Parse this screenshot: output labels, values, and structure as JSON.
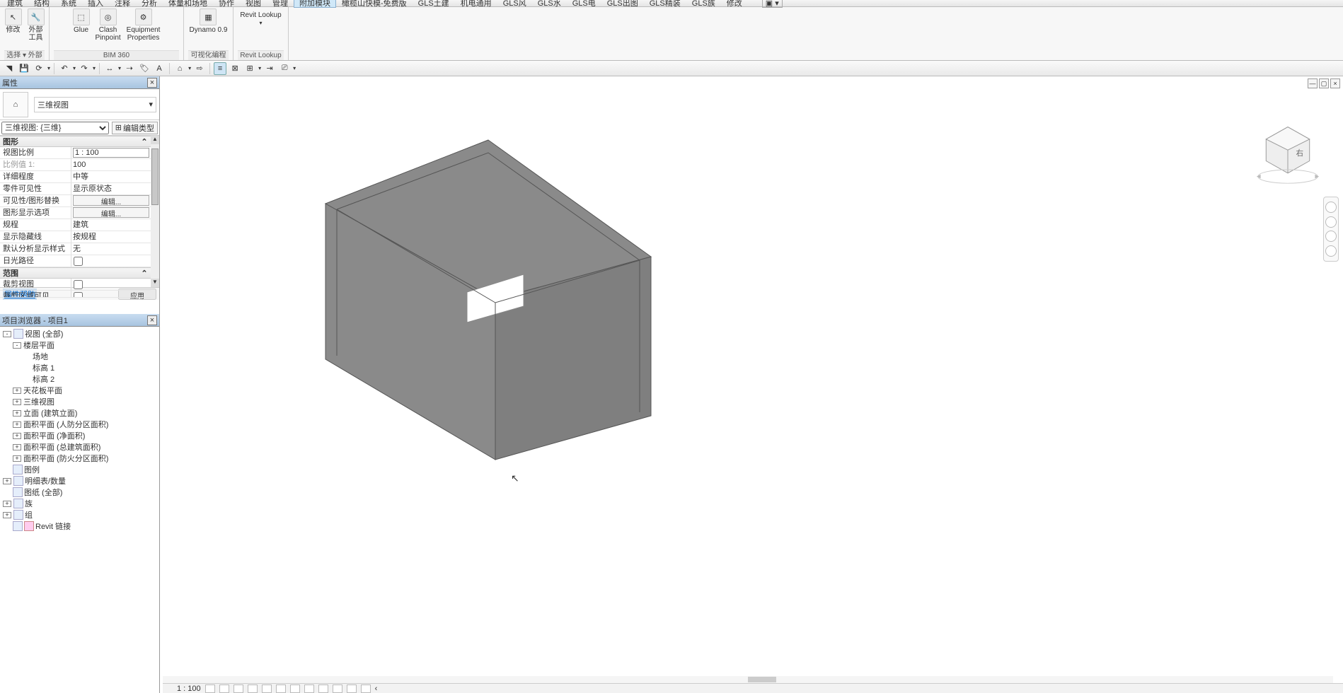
{
  "menu": {
    "items": [
      "建筑",
      "结构",
      "系统",
      "插入",
      "注释",
      "分析",
      "体量和场地",
      "协作",
      "视图",
      "管理",
      "附加模块",
      "橄榄山快模-免费版",
      "GLS土建",
      "机电通用",
      "GLS风",
      "GLS水",
      "GLS电",
      "GLS出图",
      "GLS精装",
      "GLS族",
      "修改"
    ],
    "active_index": 10
  },
  "ribbon": {
    "g0": {
      "t1": "修改",
      "t2": "外部\n工具",
      "title": "选择 ▾   外部"
    },
    "g1": {
      "t1": "Glue",
      "t2": "Clash\nPinpoint",
      "t3": "Equipment\nProperties",
      "title": "BIM 360"
    },
    "g2": {
      "t1": "Dynamo 0.9",
      "title": "可视化编程"
    },
    "g3": {
      "t1": "Revit Lookup",
      "title": "Revit Lookup"
    }
  },
  "qat": {
    "dropdown": "▾"
  },
  "properties": {
    "title": "属性",
    "type": "三维视图",
    "instance_label": "三维视图: {三维}",
    "edit_type": "编辑类型",
    "cat1": "图形",
    "rows": [
      {
        "l": "视图比例",
        "v": "1 : 100",
        "type": "input"
      },
      {
        "l": "比例值 1:",
        "v": "100",
        "type": "text",
        "dim": true
      },
      {
        "l": "详细程度",
        "v": "中等",
        "type": "text"
      },
      {
        "l": "零件可见性",
        "v": "显示原状态",
        "type": "text"
      },
      {
        "l": "可见性/图形替换",
        "v": "编辑...",
        "type": "btn"
      },
      {
        "l": "图形显示选项",
        "v": "编辑...",
        "type": "btn"
      },
      {
        "l": "规程",
        "v": "建筑",
        "type": "text"
      },
      {
        "l": "显示隐藏线",
        "v": "按规程",
        "type": "text"
      },
      {
        "l": "默认分析显示样式",
        "v": "无",
        "type": "text"
      },
      {
        "l": "日光路径",
        "v": "",
        "type": "check"
      }
    ],
    "cat2": "范围",
    "rows2": [
      {
        "l": "裁剪视图",
        "v": "",
        "type": "check"
      },
      {
        "l": "裁剪区域可见",
        "v": "",
        "type": "check"
      }
    ],
    "help": "属性帮助",
    "apply": "应用"
  },
  "browser": {
    "title": "项目浏览器 - 项目1",
    "tree": [
      {
        "ind": 1,
        "exp": "-",
        "icon": true,
        "label": "视图 (全部)"
      },
      {
        "ind": 2,
        "exp": "-",
        "label": "楼层平面"
      },
      {
        "ind": 3,
        "label": "场地"
      },
      {
        "ind": 3,
        "label": "标高 1"
      },
      {
        "ind": 3,
        "label": "标高 2"
      },
      {
        "ind": 2,
        "exp": "+",
        "label": "天花板平面"
      },
      {
        "ind": 2,
        "exp": "+",
        "label": "三维视图"
      },
      {
        "ind": 2,
        "exp": "+",
        "label": "立面 (建筑立面)"
      },
      {
        "ind": 2,
        "exp": "+",
        "label": "面积平面 (人防分区面积)"
      },
      {
        "ind": 2,
        "exp": "+",
        "label": "面积平面 (净面积)"
      },
      {
        "ind": 2,
        "exp": "+",
        "label": "面积平面 (总建筑面积)"
      },
      {
        "ind": 2,
        "exp": "+",
        "label": "面积平面 (防火分区面积)"
      },
      {
        "ind": 1,
        "icon": true,
        "label": "图例"
      },
      {
        "ind": 1,
        "exp": "+",
        "icon": true,
        "label": "明细表/数量"
      },
      {
        "ind": 1,
        "icon": true,
        "label": "图纸 (全部)"
      },
      {
        "ind": 1,
        "exp": "+",
        "icon": true,
        "label": "族"
      },
      {
        "ind": 1,
        "exp": "+",
        "icon": true,
        "label": "组"
      },
      {
        "ind": 1,
        "icon": true,
        "label": "Revit 链接",
        "link": true
      }
    ]
  },
  "viewbar": {
    "scale": "1 : 100"
  }
}
